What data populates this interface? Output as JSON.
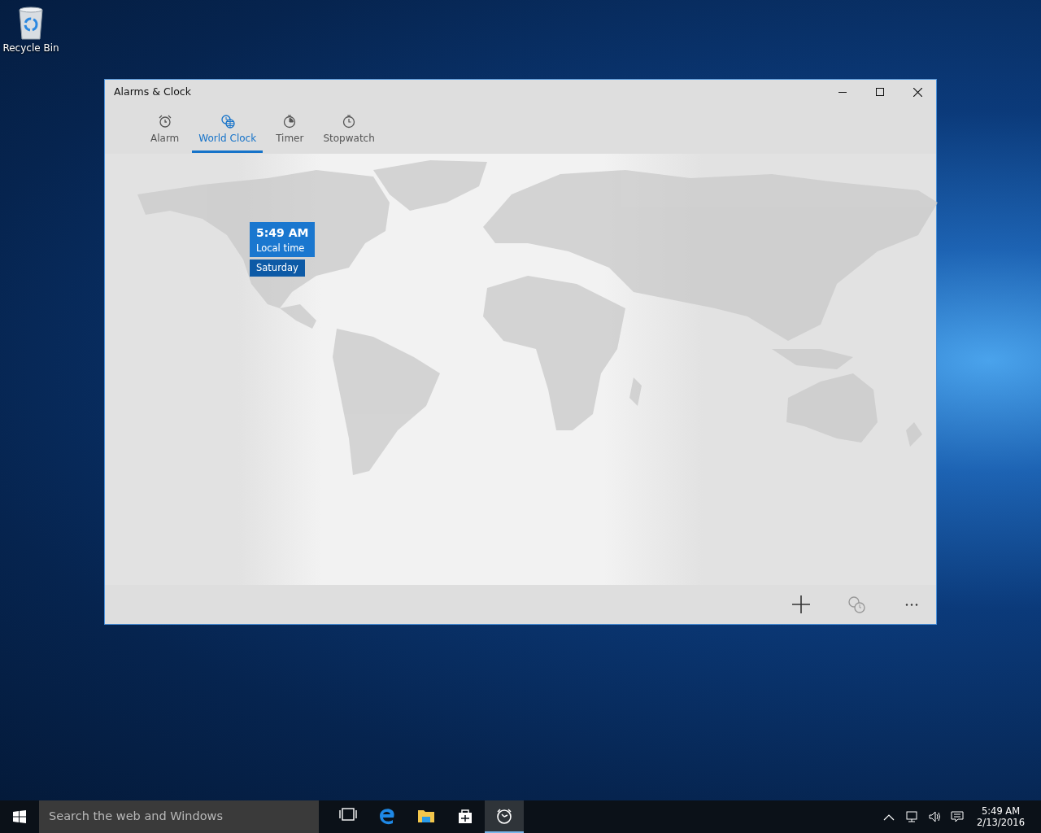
{
  "desktop_icons": [
    {
      "label": "Recycle Bin"
    }
  ],
  "window": {
    "title": "Alarms & Clock",
    "tabs": [
      {
        "kind": "alarm",
        "label": "Alarm",
        "selected": false
      },
      {
        "kind": "world-clock",
        "label": "World Clock",
        "selected": true
      },
      {
        "kind": "timer",
        "label": "Timer",
        "selected": false
      },
      {
        "kind": "stopwatch",
        "label": "Stopwatch",
        "selected": false
      }
    ],
    "map": {
      "pins": [
        {
          "time": "5:49 AM",
          "caption": "Local time",
          "day": "Saturday"
        }
      ]
    }
  },
  "taskbar": {
    "search": {
      "placeholder": "Search the web and Windows"
    },
    "apps": [
      {
        "kind": "task-view",
        "selected": false
      },
      {
        "kind": "browser",
        "selected": false
      },
      {
        "kind": "folder",
        "selected": false
      },
      {
        "kind": "store",
        "selected": false
      },
      {
        "kind": "alarm-clock",
        "selected": true
      }
    ],
    "clock": {
      "time": "5:49 AM",
      "date": "2/13/2016"
    }
  }
}
